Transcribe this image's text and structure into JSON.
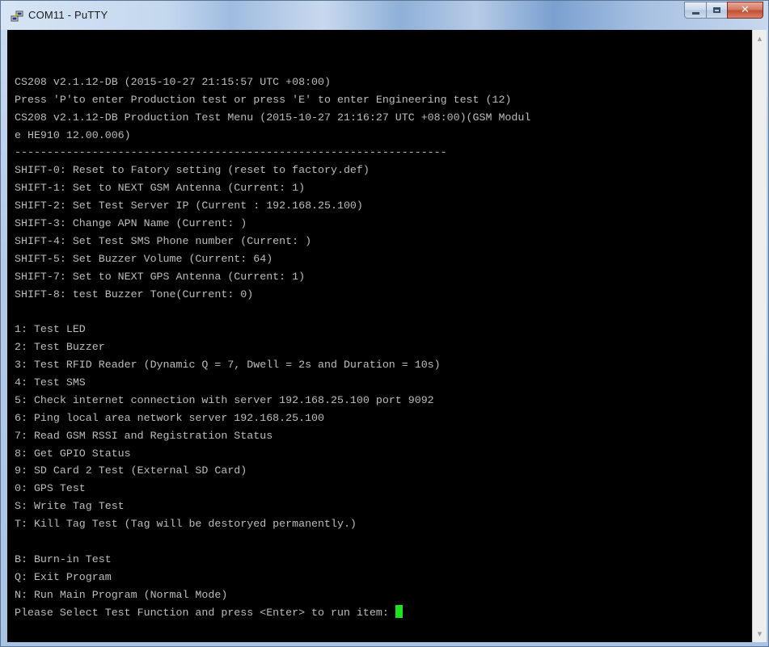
{
  "window": {
    "title": "COM11 - PuTTY",
    "icon": "putty-icon",
    "buttons": {
      "minimize": "minimize-icon",
      "maximize": "maximize-icon",
      "close": "✕"
    }
  },
  "terminal": {
    "lines": [
      "",
      "CS208 v2.1.12-DB (2015-10-27 21:15:57 UTC +08:00)",
      "Press 'P'to enter Production test or press 'E' to enter Engineering test (12)",
      "CS208 v2.1.12-DB Production Test Menu (2015-10-27 21:16:27 UTC +08:00)(GSM Modul",
      "e HE910 12.00.006)",
      "-------------------------------------------------------------------",
      "SHIFT-0: Reset to Fatory setting (reset to factory.def)",
      "SHIFT-1: Set to NEXT GSM Antenna (Current: 1)",
      "SHIFT-2: Set Test Server IP (Current : 192.168.25.100)",
      "SHIFT-3: Change APN Name (Current: )",
      "SHIFT-4: Set Test SMS Phone number (Current: )",
      "SHIFT-5: Set Buzzer Volume (Current: 64)",
      "SHIFT-7: Set to NEXT GPS Antenna (Current: 1)",
      "SHIFT-8: test Buzzer Tone(Current: 0)",
      "",
      "1: Test LED",
      "2: Test Buzzer",
      "3: Test RFID Reader (Dynamic Q = 7, Dwell = 2s and Duration = 10s)",
      "4: Test SMS",
      "5: Check internet connection with server 192.168.25.100 port 9092",
      "6: Ping local area network server 192.168.25.100",
      "7: Read GSM RSSI and Registration Status",
      "8: Get GPIO Status",
      "9: SD Card 2 Test (External SD Card)",
      "0: GPS Test",
      "S: Write Tag Test",
      "T: Kill Tag Test (Tag will be destoryed permanently.)",
      "",
      "B: Burn-in Test",
      "Q: Exit Program",
      "N: Run Main Program (Normal Mode)"
    ],
    "prompt": "Please Select Test Function and press <Enter> to run item:",
    "cursor_color": "#1fe01f",
    "text_color": "#bdbdbd",
    "background_color": "#000000"
  },
  "scrollbar": {
    "up_icon": "▲",
    "down_icon": "▼"
  }
}
